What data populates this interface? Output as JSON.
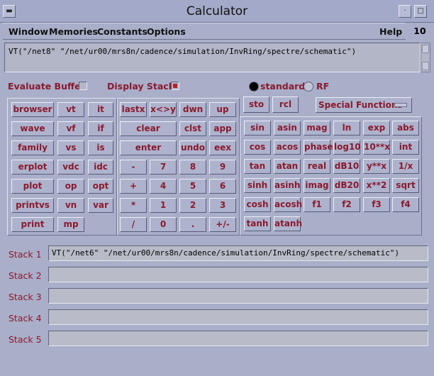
{
  "window": {
    "title": "Calculator"
  },
  "menubar": {
    "items": [
      "Window",
      "Memories",
      "Constants",
      "Options"
    ],
    "help": "Help",
    "count": "10"
  },
  "buffer": {
    "value": "VT(\"/net8\" \"/net/ur00/mrs8n/cadence/simulation/InvRing/spectre/schematic\")"
  },
  "options": {
    "evaluate_buffer": {
      "label": "Evaluate Buffer",
      "checked": false
    },
    "display_stack": {
      "label": "Display Stack",
      "checked": true
    },
    "mode_standard": "standard",
    "mode_rf": "RF",
    "selected_mode": "standard"
  },
  "left_panel": {
    "col1": [
      "browser",
      "wave",
      "family",
      "erplot",
      "plot",
      "printvs",
      "print"
    ],
    "col2": [
      "vt",
      "vf",
      "vs",
      "vdc",
      "op",
      "vn",
      "mp"
    ],
    "col3": [
      "it",
      "if",
      "is",
      "idc",
      "opt",
      "var"
    ]
  },
  "keypad": {
    "row1": [
      "lastx",
      "x<>y",
      "dwn",
      "up"
    ],
    "clear": "clear",
    "clst": "clst",
    "app": "app",
    "enter": "enter",
    "undo": "undo",
    "eex": "eex",
    "rows": [
      [
        "-",
        "7",
        "8",
        "9"
      ],
      [
        "+",
        "4",
        "5",
        "6"
      ],
      [
        "*",
        "1",
        "2",
        "3"
      ],
      [
        "/",
        "0",
        ".",
        "+/-"
      ]
    ]
  },
  "memory": {
    "sto": "sto",
    "rcl": "rcl"
  },
  "special_functions": "Special Functions",
  "functions": [
    [
      "sin",
      "asin",
      "mag",
      "ln",
      "exp",
      "abs"
    ],
    [
      "cos",
      "acos",
      "phase",
      "log10",
      "10**x",
      "int"
    ],
    [
      "tan",
      "atan",
      "real",
      "dB10",
      "y**x",
      "1/x"
    ],
    [
      "sinh",
      "asinh",
      "imag",
      "dB20",
      "x**2",
      "sqrt"
    ],
    [
      "cosh",
      "acosh",
      "f1",
      "f2",
      "f3",
      "f4"
    ],
    [
      "tanh",
      "atanh"
    ]
  ],
  "stack": [
    {
      "label": "Stack 1",
      "value": "VT(\"/net6\" \"/net/ur00/mrs8n/cadence/simulation/InvRing/spectre/schematic\")"
    },
    {
      "label": "Stack 2",
      "value": ""
    },
    {
      "label": "Stack 3",
      "value": ""
    },
    {
      "label": "Stack 4",
      "value": ""
    },
    {
      "label": "Stack 5",
      "value": ""
    }
  ]
}
